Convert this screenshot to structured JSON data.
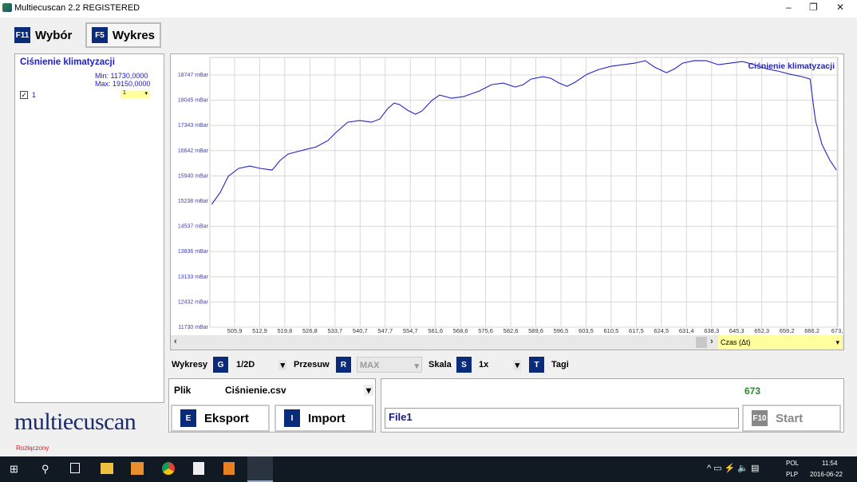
{
  "window": {
    "title": "Multiecuscan 2.2 REGISTERED",
    "minimize": "–",
    "maximize": "❐",
    "close": "✕"
  },
  "tabs": [
    {
      "key": "F11",
      "label": "Wybór"
    },
    {
      "key": "F5",
      "label": "Wykres"
    }
  ],
  "left_panel": {
    "title": "Ciśnienie klimatyzacji",
    "min": "Min: 11730,0000",
    "max": "Max: 19150,0000",
    "item_label": "1",
    "item_select": "1",
    "logo": "multiecuscan"
  },
  "chart_data": {
    "type": "line",
    "title": "Ciśnienie klimatyzacji",
    "xlabel": "Czas (Δt)",
    "ylabel": "mBar",
    "unit": "mBar",
    "xlim": [
      499.0,
      673.4
    ],
    "ylim": [
      11730,
      19150
    ],
    "yticks": [
      18747,
      18045,
      17343,
      16642,
      15940,
      15238,
      14537,
      13836,
      13133,
      12432,
      11730
    ],
    "xticks": [
      "505,9",
      "512,9",
      "519,8",
      "526,8",
      "533,7",
      "540,7",
      "547,7",
      "554,7",
      "561,6",
      "568,6",
      "575,6",
      "582,6",
      "589,6",
      "596,5",
      "603,5",
      "610,5",
      "617,5",
      "624,5",
      "631,4",
      "638,3",
      "645,3",
      "652,3",
      "659,2",
      "666,2",
      "673,"
    ],
    "series": [
      {
        "name": "Ciśnienie klimatyzacji",
        "color": "#2222cc",
        "x": [
          499.5,
          501.9,
          504.1,
          507.0,
          510.1,
          513.0,
          516.3,
          518.5,
          520.7,
          524.0,
          528.5,
          531.8,
          534.0,
          537.3,
          540.6,
          543.9,
          546.2,
          548.4,
          550.2,
          551.7,
          553.9,
          556.1,
          557.9,
          560.6,
          562.8,
          566.1,
          569.4,
          573.8,
          577.2,
          580.5,
          583.8,
          586.0,
          588.2,
          591.5,
          593.7,
          596.0,
          598.2,
          600.4,
          603.7,
          607.0,
          610.4,
          613.7,
          617.0,
          619.9,
          622.5,
          625.8,
          628.1,
          630.3,
          633.6,
          636.9,
          640.2,
          643.6,
          646.9,
          650.2,
          653.5,
          656.8,
          660.2,
          663.5,
          665.7,
          666.3,
          667.2,
          669.0,
          671.2,
          673.0
        ],
        "y": [
          15149,
          15482,
          15926,
          16148,
          16214,
          16148,
          16103,
          16370,
          16547,
          16636,
          16747,
          16925,
          17147,
          17435,
          17480,
          17435,
          17524,
          17813,
          17968,
          17924,
          17768,
          17657,
          17746,
          18035,
          18190,
          18101,
          18146,
          18301,
          18479,
          18523,
          18412,
          18479,
          18634,
          18701,
          18656,
          18523,
          18434,
          18545,
          18767,
          18901,
          18989,
          19034,
          19078,
          19145,
          18967,
          18812,
          18923,
          19078,
          19150,
          19145,
          19034,
          19078,
          19123,
          19034,
          18923,
          18856,
          18767,
          18701,
          18634,
          18146,
          17480,
          16814,
          16370,
          16103
        ]
      }
    ]
  },
  "xaxis_select": "Czas (Δt)",
  "controls": {
    "wykresy_label": "Wykresy",
    "wykresy_key": "G",
    "wykresy_value": "1/2D",
    "przesuw_label": "Przesuw",
    "przesuw_key": "R",
    "przesuw_value": "MAX",
    "skala_label": "Skala",
    "skala_key": "S",
    "skala_value": "1x",
    "tagi_key": "T",
    "tagi_label": "Tagi"
  },
  "file": {
    "label": "Plik",
    "value": "Ciśnienie.csv",
    "export_key": "E",
    "export_label": "Eksport",
    "import_key": "I",
    "import_label": "Import"
  },
  "record": {
    "count": "673",
    "name": "File1",
    "start_key": "F10",
    "start_label": "Start"
  },
  "status": "Rozłączony",
  "taskbar": {
    "lang1": "POL",
    "lang2": "PLP",
    "time": "11:54",
    "date": "2016-06-22"
  }
}
